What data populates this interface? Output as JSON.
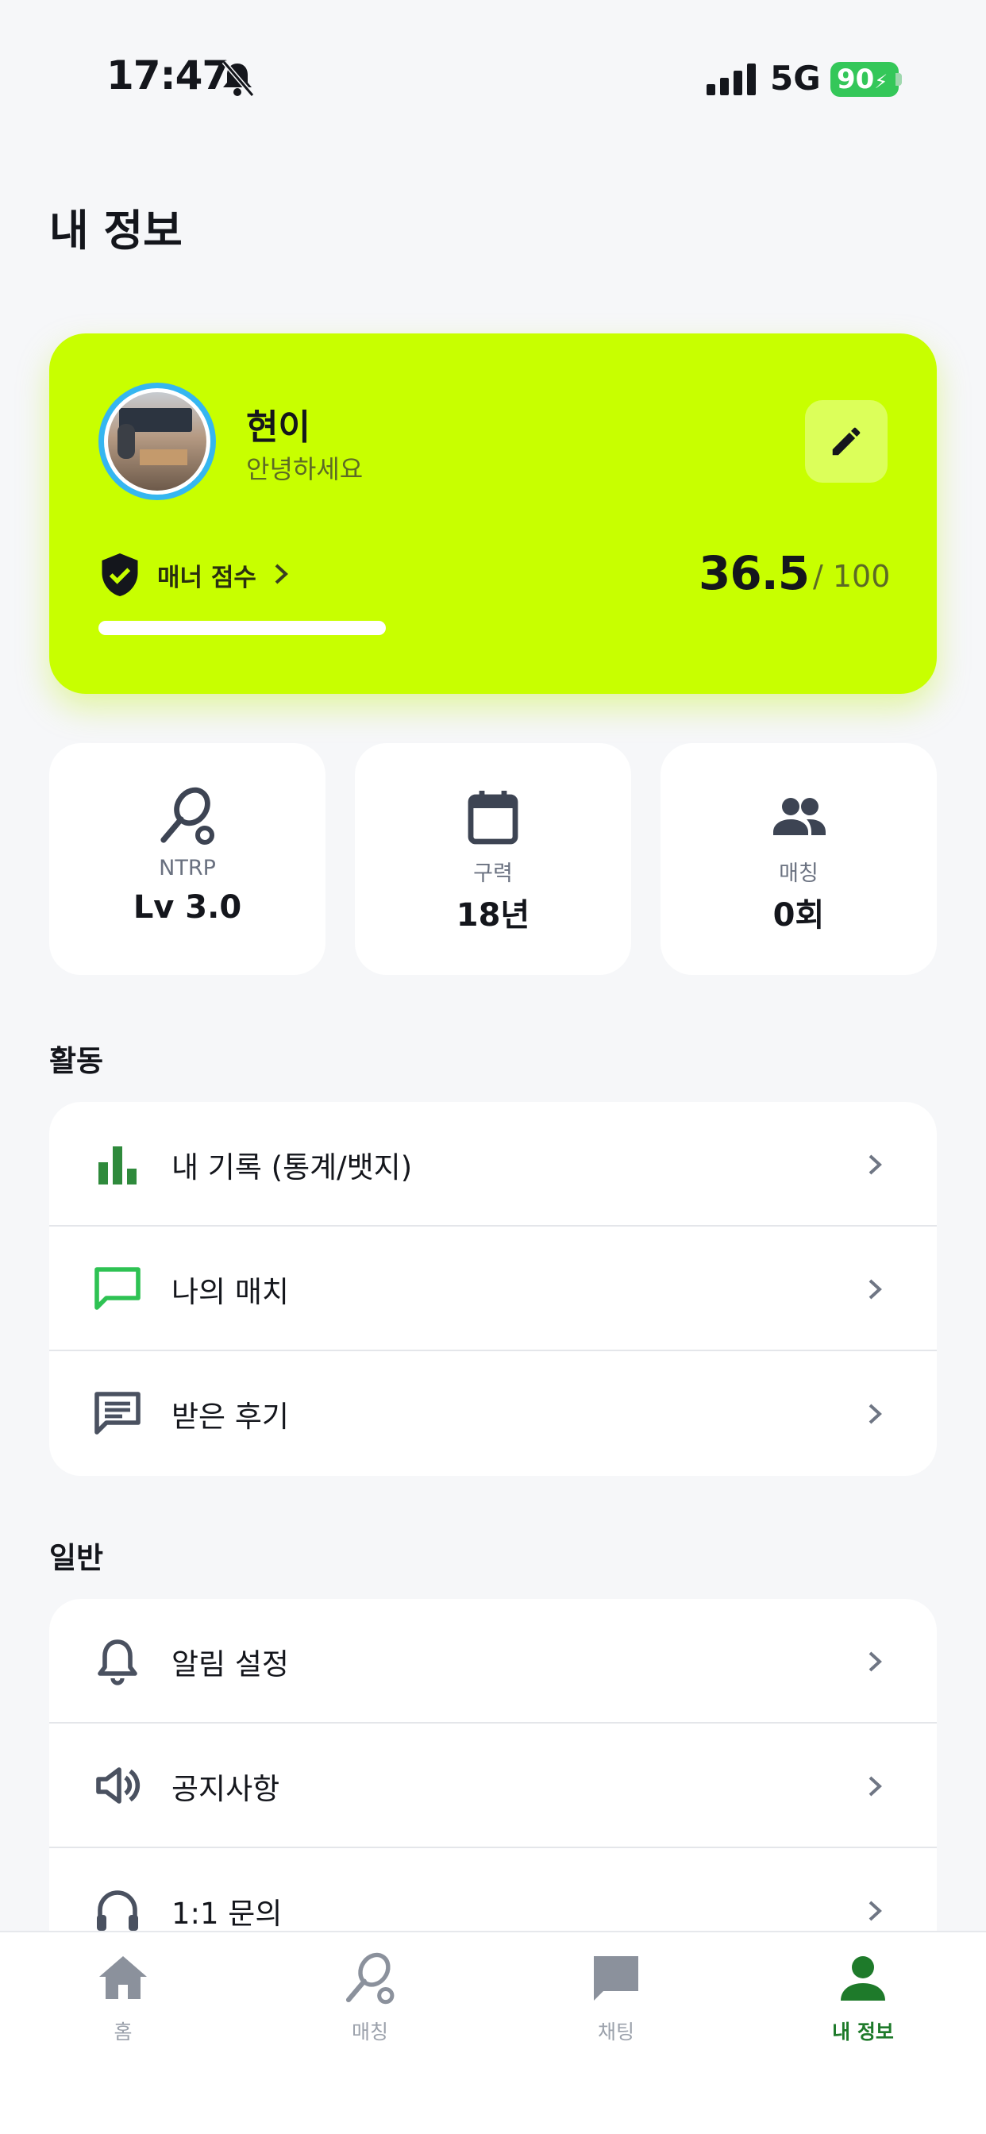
{
  "status_bar": {
    "time": "17:47",
    "network": "5G",
    "battery": "90"
  },
  "header": {
    "title": "내 정보"
  },
  "profile": {
    "name": "현이",
    "greeting": "안녕하세요",
    "manner_label": "매너 점수",
    "score": "36.5",
    "score_max": "/ 100",
    "score_fraction": 0.365,
    "accent": "#c8ff00"
  },
  "stats": [
    {
      "icon": "racket-icon",
      "label": "NTRP",
      "value": "Lv 3.0"
    },
    {
      "icon": "calendar-icon",
      "label": "구력",
      "value": "18년"
    },
    {
      "icon": "people-icon",
      "label": "매칭",
      "value": "0회"
    }
  ],
  "activity": {
    "title": "활동",
    "items": [
      {
        "icon": "bar-chart-icon",
        "label": "내 기록 (통계/뱃지)"
      },
      {
        "icon": "chat-bubble-icon",
        "label": "나의 매치"
      },
      {
        "icon": "review-icon",
        "label": "받은 후기"
      }
    ]
  },
  "general": {
    "title": "일반",
    "items": [
      {
        "icon": "bell-icon",
        "label": "알림 설정"
      },
      {
        "icon": "speaker-icon",
        "label": "공지사항"
      },
      {
        "icon": "headset-icon",
        "label": "1:1 문의"
      }
    ]
  },
  "tabbar": {
    "items": [
      {
        "icon": "home-icon",
        "label": "홈"
      },
      {
        "icon": "racket-icon",
        "label": "매칭"
      },
      {
        "icon": "chat-icon",
        "label": "채팅"
      },
      {
        "icon": "person-icon",
        "label": "내 정보"
      }
    ],
    "active": "내 정보",
    "active_color": "#1e7a2a"
  }
}
